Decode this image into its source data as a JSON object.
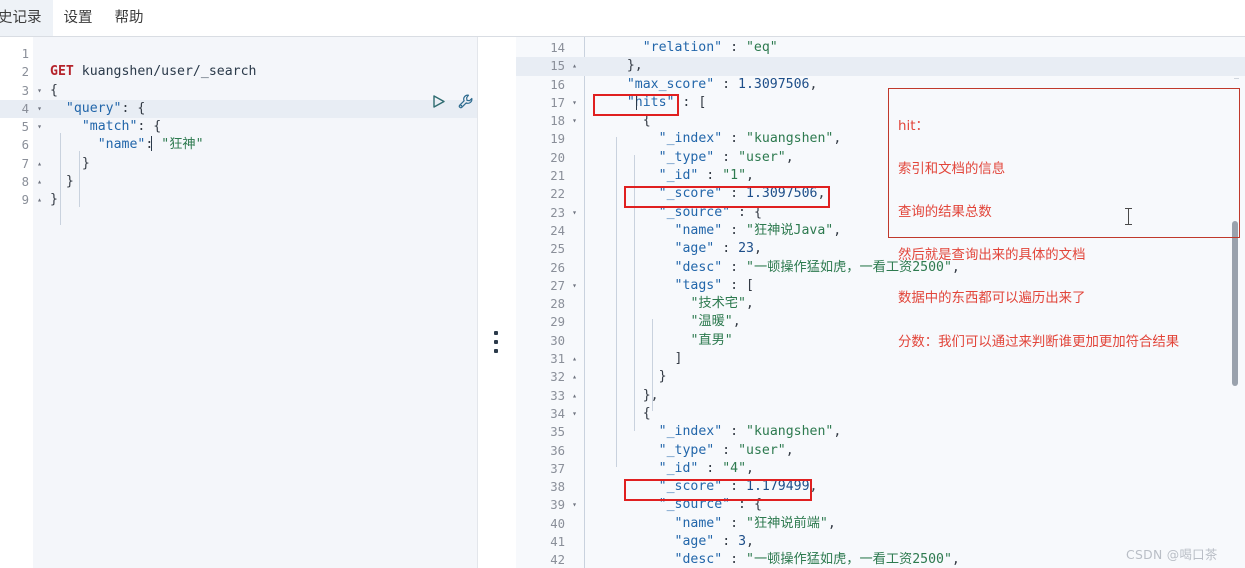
{
  "menubar": {
    "items": [
      {
        "label": "史记录",
        "name": "menu-history"
      },
      {
        "label": "设置",
        "name": "menu-settings"
      },
      {
        "label": "帮助",
        "name": "menu-help"
      }
    ]
  },
  "request_editor": {
    "method": "GET",
    "path": "kuangshen/user/_search",
    "play_icon": "play-icon",
    "wrench_icon": "wrench-icon",
    "active_line": 4,
    "lines": [
      {
        "n": "1",
        "fold": "",
        "text": ""
      },
      {
        "n": "2",
        "fold": "",
        "text": "GET kuangshen/user/_search"
      },
      {
        "n": "3",
        "fold": "▾",
        "text": "{"
      },
      {
        "n": "4",
        "fold": "▾",
        "text": "  \"query\": {"
      },
      {
        "n": "5",
        "fold": "▾",
        "text": "    \"match\": {"
      },
      {
        "n": "6",
        "fold": "",
        "text": "      \"name\": \"狂神\""
      },
      {
        "n": "7",
        "fold": "▴",
        "text": "    }"
      },
      {
        "n": "8",
        "fold": "▴",
        "text": "  }"
      },
      {
        "n": "9",
        "fold": "▴",
        "text": "}"
      }
    ]
  },
  "response_viewer": {
    "active_line": 15,
    "lines": [
      {
        "n": "14",
        "fold": "",
        "text": "      \"relation\" : \"eq\""
      },
      {
        "n": "15",
        "fold": "▴",
        "text": "    },"
      },
      {
        "n": "16",
        "fold": "",
        "text": "    \"max_score\" : 1.3097506,"
      },
      {
        "n": "17",
        "fold": "▾",
        "text": "    \"hits\" : ["
      },
      {
        "n": "18",
        "fold": "▾",
        "text": "      {"
      },
      {
        "n": "19",
        "fold": "",
        "text": "        \"_index\" : \"kuangshen\","
      },
      {
        "n": "20",
        "fold": "",
        "text": "        \"_type\" : \"user\","
      },
      {
        "n": "21",
        "fold": "",
        "text": "        \"_id\" : \"1\","
      },
      {
        "n": "22",
        "fold": "",
        "text": "        \"_score\" : 1.3097506,"
      },
      {
        "n": "23",
        "fold": "▾",
        "text": "        \"_source\" : {"
      },
      {
        "n": "24",
        "fold": "",
        "text": "          \"name\" : \"狂神说Java\","
      },
      {
        "n": "25",
        "fold": "",
        "text": "          \"age\" : 23,"
      },
      {
        "n": "26",
        "fold": "",
        "text": "          \"desc\" : \"一顿操作猛如虎，一看工资2500\","
      },
      {
        "n": "27",
        "fold": "▾",
        "text": "          \"tags\" : ["
      },
      {
        "n": "28",
        "fold": "",
        "text": "            \"技术宅\","
      },
      {
        "n": "29",
        "fold": "",
        "text": "            \"温暖\","
      },
      {
        "n": "30",
        "fold": "",
        "text": "            \"直男\""
      },
      {
        "n": "31",
        "fold": "▴",
        "text": "          ]"
      },
      {
        "n": "32",
        "fold": "▴",
        "text": "        }"
      },
      {
        "n": "33",
        "fold": "▴",
        "text": "      },"
      },
      {
        "n": "34",
        "fold": "▾",
        "text": "      {"
      },
      {
        "n": "35",
        "fold": "",
        "text": "        \"_index\" : \"kuangshen\","
      },
      {
        "n": "36",
        "fold": "",
        "text": "        \"_type\" : \"user\","
      },
      {
        "n": "37",
        "fold": "",
        "text": "        \"_id\" : \"4\","
      },
      {
        "n": "38",
        "fold": "",
        "text": "        \"_score\" : 1.179499,"
      },
      {
        "n": "39",
        "fold": "▾",
        "text": "        \"_source\" : {"
      },
      {
        "n": "40",
        "fold": "",
        "text": "          \"name\" : \"狂神说前端\","
      },
      {
        "n": "41",
        "fold": "",
        "text": "          \"age\" : 3,"
      },
      {
        "n": "42",
        "fold": "",
        "text": "          \"desc\" : \"一顿操作猛如虎，一看工资2500\","
      }
    ]
  },
  "annotation": {
    "title": "hit：",
    "lines": [
      "索引和文档的信息",
      "查询的结果总数",
      "然后就是查询出来的具体的文档",
      "数据中的东西都可以遍历出来了",
      "分数：我们可以通过来判断谁更加更加符合结果"
    ],
    "color": "#e2453a"
  },
  "highlights": {
    "hits_box": "hits",
    "score_box_1": "_score : 1.3097506",
    "score_box_2": "_score : 1.179499",
    "color": "#e02020"
  },
  "watermark": {
    "text": "CSDN @喝口茶"
  }
}
